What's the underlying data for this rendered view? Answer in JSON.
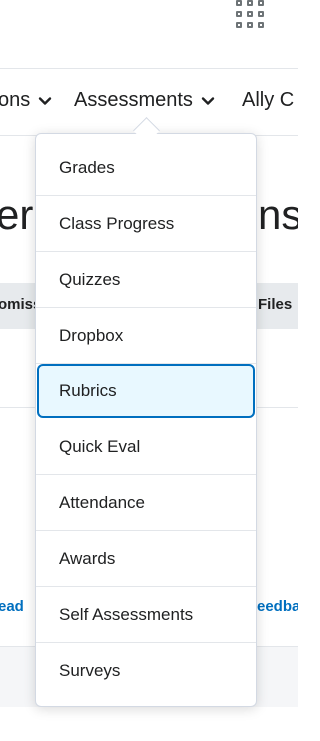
{
  "header": {
    "apps_icon": "waffle-grid-icon"
  },
  "nav": {
    "items": [
      {
        "label": "ons",
        "chevron": "chevron-down-icon"
      },
      {
        "label": "Assessments",
        "chevron": "chevron-down-icon"
      },
      {
        "label": "Ally C"
      }
    ]
  },
  "background": {
    "heading_left": "er",
    "heading_right": "ns",
    "band_left": "omiss",
    "band_right": "Files",
    "link_left": "ead",
    "link_right": "eedba"
  },
  "dropdown": {
    "items": [
      {
        "label": "Grades"
      },
      {
        "label": "Class Progress"
      },
      {
        "label": "Quizzes"
      },
      {
        "label": "Dropbox"
      },
      {
        "label": "Rubrics",
        "selected": true
      },
      {
        "label": "Quick Eval"
      },
      {
        "label": "Attendance"
      },
      {
        "label": "Awards"
      },
      {
        "label": "Self Assessments"
      },
      {
        "label": "Surveys"
      }
    ]
  },
  "colors": {
    "accent": "#006fbf",
    "selected_bg": "#e8f8ff",
    "text": "#202122",
    "border": "#d3d9e3"
  }
}
